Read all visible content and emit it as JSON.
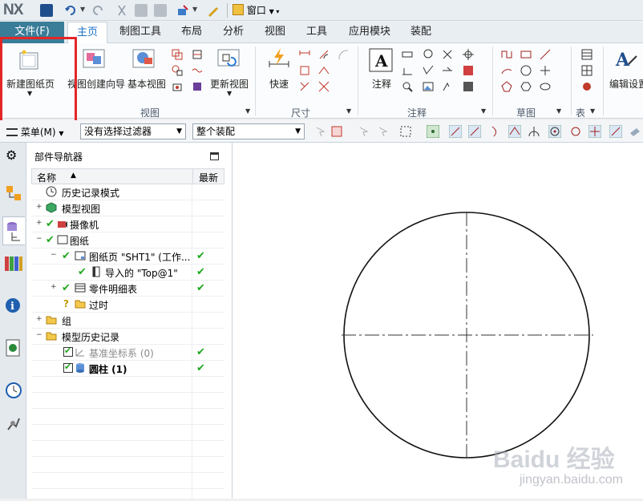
{
  "app": {
    "logo": "NX",
    "window_menu": "窗口"
  },
  "tabs": [
    {
      "label": "文件(F)"
    },
    {
      "label": "主页"
    },
    {
      "label": "制图工具"
    },
    {
      "label": "布局"
    },
    {
      "label": "分析"
    },
    {
      "label": "视图"
    },
    {
      "label": "工具"
    },
    {
      "label": "应用模块"
    },
    {
      "label": "装配"
    }
  ],
  "ribbon": {
    "new_sheet": "新建图纸页",
    "view_wizard": "视图创建向导",
    "base_view": "基本视图",
    "update_view": "更新视图",
    "rapid": "快速",
    "note": "注释",
    "edit_settings": "编辑设置",
    "groups": {
      "view": "视图",
      "dimension": "尺寸",
      "annotation": "注释",
      "sketch": "草图",
      "table": "表"
    }
  },
  "selbar": {
    "menu": "菜单(M)",
    "filter": "没有选择过滤器",
    "scope": "整个装配"
  },
  "navigator": {
    "title": "部件导航器",
    "col_name": "名称",
    "col_latest": "最新",
    "rows": [
      {
        "text": "历史记录模式"
      },
      {
        "text": "模型视图"
      },
      {
        "text": "摄像机"
      },
      {
        "text": "图纸"
      },
      {
        "text": "图纸页 \"SHT1\" (工作..."
      },
      {
        "text": "导入的 \"Top@1\""
      },
      {
        "text": "零件明细表"
      },
      {
        "text": "过时"
      },
      {
        "text": "组"
      },
      {
        "text": "模型历史记录"
      },
      {
        "text": "基准坐标系 (0)"
      },
      {
        "text": "圆柱 (1)"
      }
    ]
  },
  "watermark": {
    "brand": "Baidu 经验",
    "url": "jingyan.baidu.com"
  },
  "colors": {
    "file_tab": "#3a7d99",
    "active_tab": "#1a6fc4",
    "highlight": "#e32626",
    "check": "#1fa81f"
  }
}
